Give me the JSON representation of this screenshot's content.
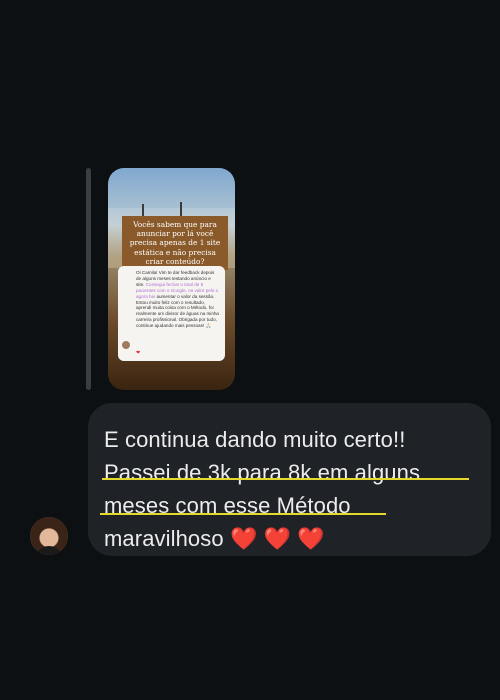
{
  "story": {
    "overlay_text": "Vocês sabem que para anunciar por lá você precisa apenas de 1 site estática e não precisa criar conteúdo?",
    "feedback_before": "Oi Camila! Vim te dar feedback depois de alguns meses testando anúncio e site. ",
    "feedback_highlight": "Consegui fechar o total de 8 pacientes com o Google, no valor pelo o agora hei ",
    "feedback_after": "aumentar o valor da sessão. Estou muito feliz com o resultado, aprendi muita coisa com o Método, foi realmente um divisor de águas na minha carreira profissional. Obrigada por tudo, continue ajudando mais pessoas! 🙏🏻",
    "heart": "❤"
  },
  "message": {
    "line1": "E continua dando muito certo!!",
    "line2": "Passei de 3k para 8k em alguns",
    "line3": "meses com esse Método",
    "line4_text": "maravilhoso",
    "line4_hearts": "❤️ ❤️ ❤️"
  },
  "colors": {
    "background": "#0d1012",
    "bubble": "#1f2226",
    "underline": "#e4d92a",
    "heart": "#e22b2b"
  }
}
